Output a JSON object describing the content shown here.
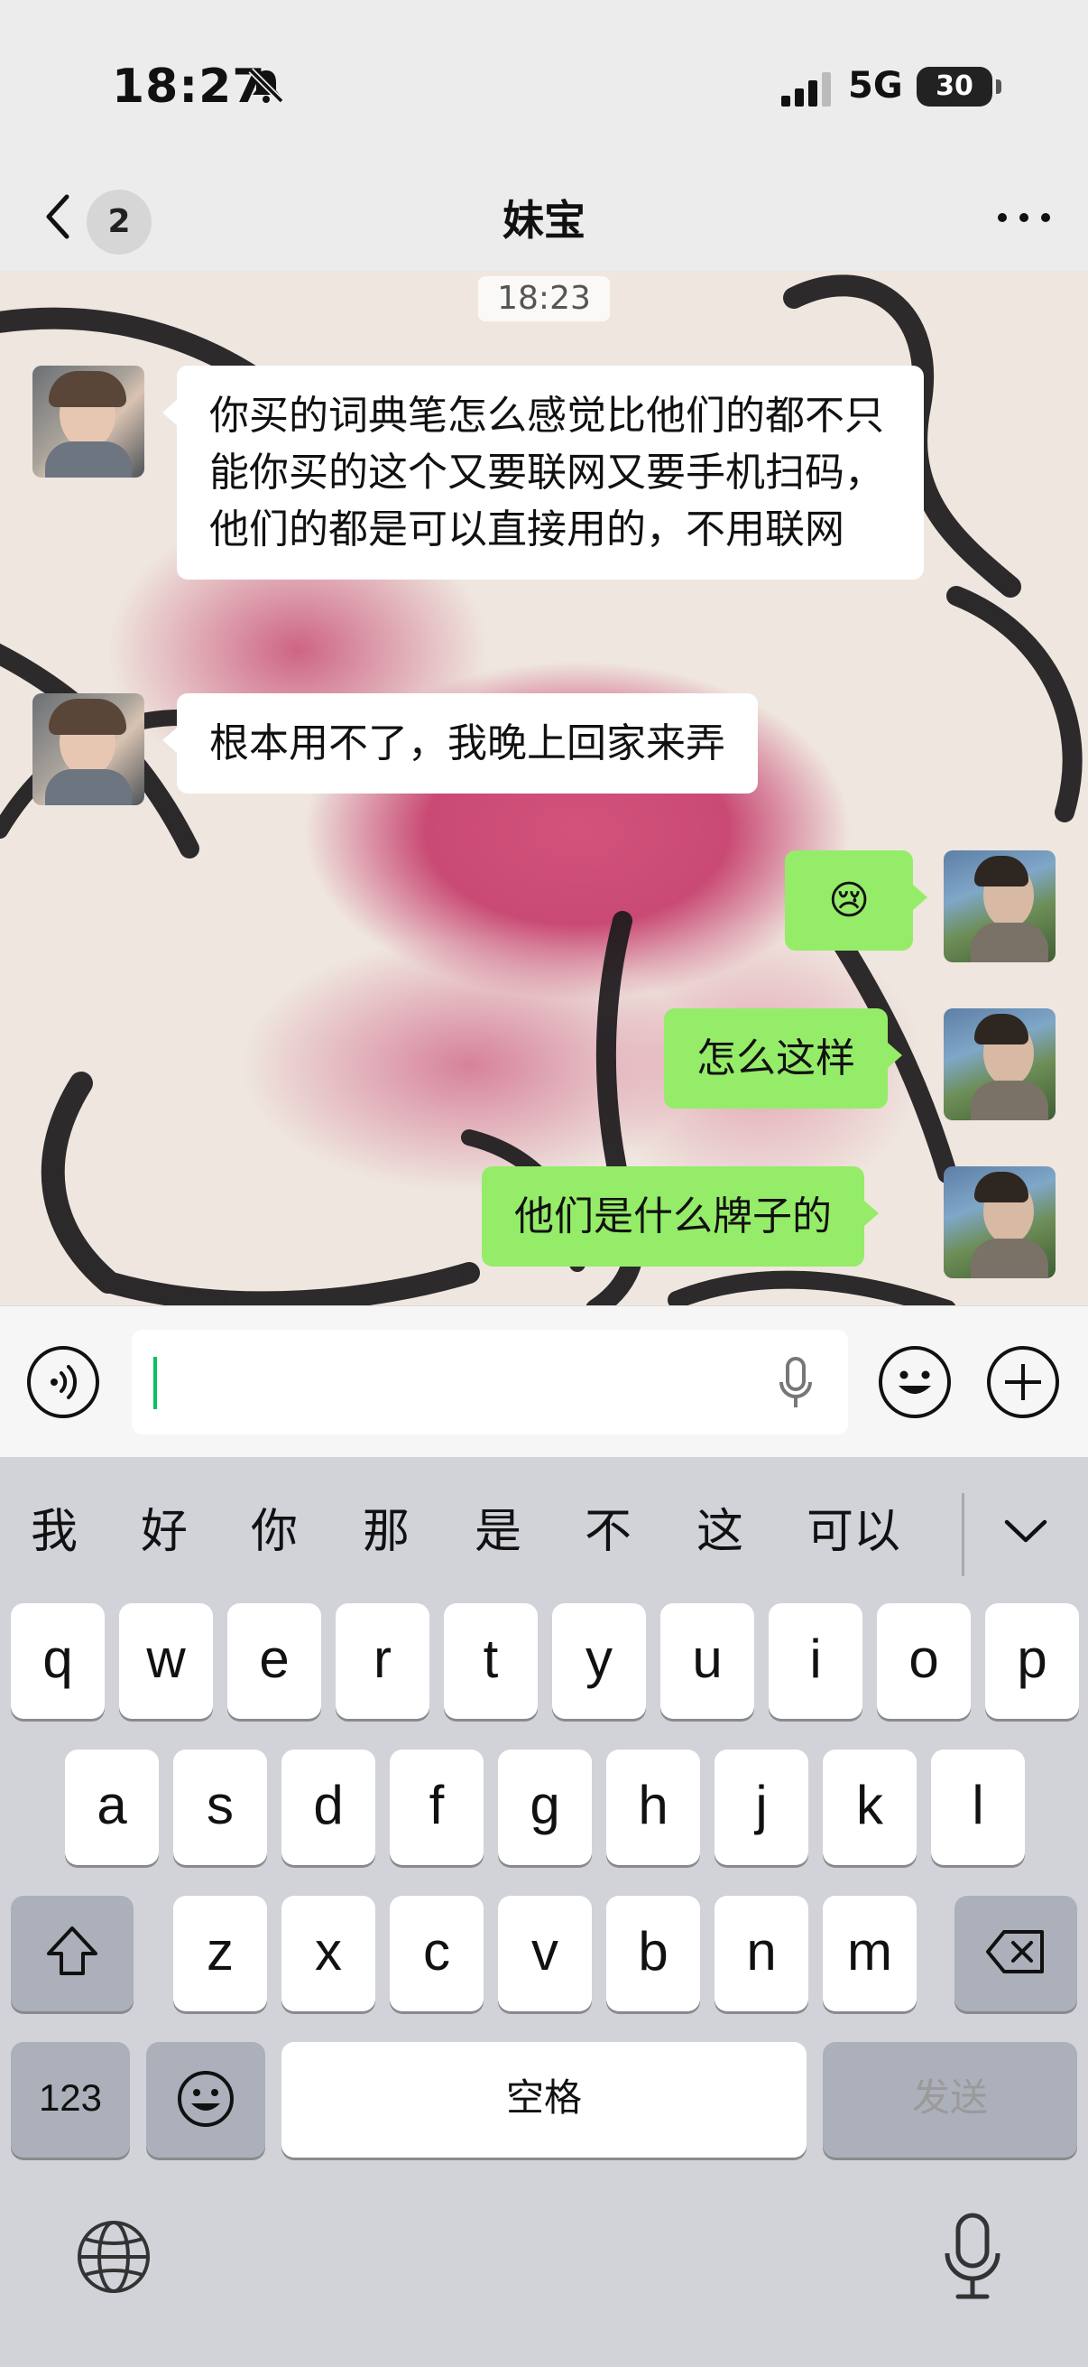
{
  "status_bar": {
    "time": "18:27",
    "network": "5G",
    "battery": "30"
  },
  "nav": {
    "unread_badge": "2",
    "title": "妹宝"
  },
  "chat": {
    "timestamp": "18:23",
    "messages": [
      {
        "side": "in",
        "text": "你买的词典笔怎么感觉比他们的都不只能你买的这个又要联网又要手机扫码，他们的都是可以直接用的，不用联网"
      },
      {
        "side": "in",
        "text": "根本用不了，我晚上回家来弄"
      },
      {
        "side": "out",
        "text": "😢"
      },
      {
        "side": "out",
        "text": "怎么这样"
      },
      {
        "side": "out",
        "text": "他们是什么牌子的"
      }
    ]
  },
  "input": {
    "value": ""
  },
  "keyboard": {
    "candidates": [
      "我",
      "好",
      "你",
      "那",
      "是",
      "不",
      "这",
      "可以"
    ],
    "row1": [
      "q",
      "w",
      "e",
      "r",
      "t",
      "y",
      "u",
      "i",
      "o",
      "p"
    ],
    "row2": [
      "a",
      "s",
      "d",
      "f",
      "g",
      "h",
      "j",
      "k",
      "l"
    ],
    "row3": [
      "z",
      "x",
      "c",
      "v",
      "b",
      "n",
      "m"
    ],
    "numbers_label": "123",
    "space_label": "空格",
    "send_label": "发送"
  },
  "icons": [
    "silent-bell-icon",
    "signal-icon",
    "back-chevron-icon",
    "more-icon",
    "voice-icon",
    "mic-icon",
    "emoji-icon",
    "plus-icon",
    "shift-icon",
    "delete-icon",
    "emoji-key-icon",
    "globe-icon",
    "dictation-icon",
    "collapse-keyboard-icon"
  ]
}
